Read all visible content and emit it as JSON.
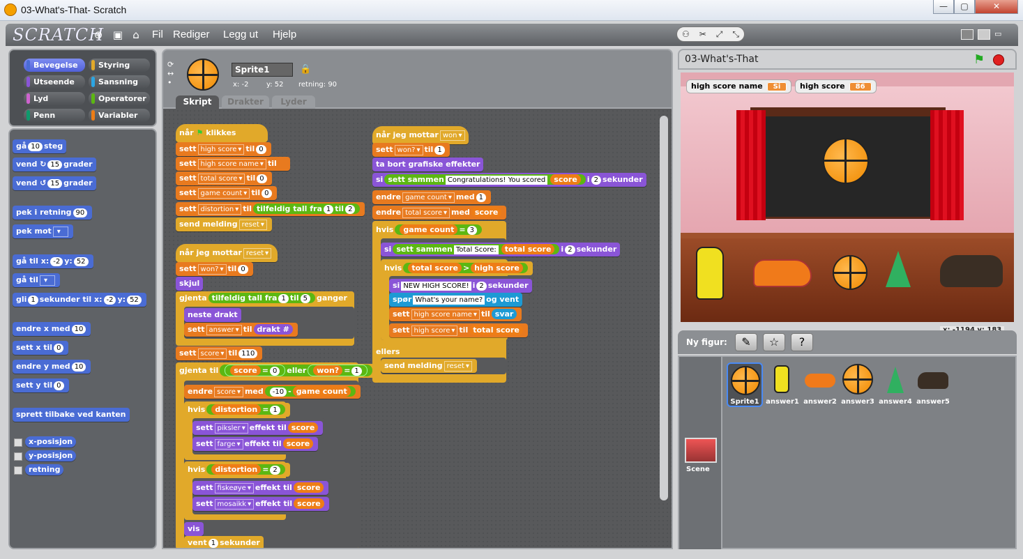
{
  "window": {
    "title": "03-What's-That- Scratch",
    "min": "—",
    "max": "▢",
    "close": "✕"
  },
  "menu": {
    "logo": "SCRATCH",
    "file": "Fil",
    "edit": "Rediger",
    "share": "Legg ut",
    "help": "Hjelp"
  },
  "categories": [
    "Bevegelse",
    "Styring",
    "Utseende",
    "Sansning",
    "Lyd",
    "Operatorer",
    "Penn",
    "Variabler"
  ],
  "palette": {
    "move": [
      "gå",
      "10",
      "steg"
    ],
    "turn_right": [
      "vend",
      "15",
      "grader"
    ],
    "turn_left": [
      "vend",
      "15",
      "grader"
    ],
    "point_dir": [
      "pek i retning",
      "90"
    ],
    "point_towards": [
      "pek mot"
    ],
    "goto_xy": [
      "gå til x:",
      "-2",
      "y:",
      "52"
    ],
    "goto": [
      "gå til"
    ],
    "glide": [
      "gli",
      "1",
      "sekunder til x:",
      "-2",
      "y:",
      "52"
    ],
    "change_x": [
      "endre x med",
      "10"
    ],
    "set_x": [
      "sett x til",
      "0"
    ],
    "change_y": [
      "endre y med",
      "10"
    ],
    "set_y": [
      "sett y til",
      "0"
    ],
    "bounce": "sprett tilbake ved kanten",
    "reporters": [
      "x-posisjon",
      "y-posisjon",
      "retning"
    ]
  },
  "sprite": {
    "name": "Sprite1",
    "x": "x: -2",
    "y": "y: 52",
    "dir": "retning: 90"
  },
  "tabs": [
    "Skript",
    "Drakter",
    "Lyder"
  ],
  "stage": {
    "title": "03-What's-That",
    "monitor1_label": "high score name",
    "monitor1_value": "Si",
    "monitor2_label": "high score",
    "monitor2_value": "86",
    "coords": "x: -1194  y: 183"
  },
  "sprite_list": {
    "new_label": "Ny figur:",
    "items": [
      "Sprite1",
      "answer1",
      "answer2",
      "answer3",
      "answer4",
      "answer5"
    ],
    "scene": "Scene"
  },
  "scripts": {
    "s1_hat": [
      "når",
      "klikkes"
    ],
    "s1_l1": [
      "sett",
      "high score",
      "til",
      "0"
    ],
    "s1_l2": [
      "sett",
      "high score name",
      "til",
      ""
    ],
    "s1_l3": [
      "sett",
      "total score",
      "til",
      "0"
    ],
    "s1_l4": [
      "sett",
      "game count",
      "til",
      "0"
    ],
    "s1_l5": [
      "sett",
      "distortion",
      "til",
      "tilfeldig tall fra",
      "1",
      "til",
      "2"
    ],
    "s1_l6": [
      "send melding",
      "reset"
    ],
    "s2_hat": [
      "når jeg mottar",
      "reset"
    ],
    "s2_l1": [
      "sett",
      "won?",
      "til",
      "0"
    ],
    "s2_l2": "skjul",
    "s2_l3": [
      "gjenta",
      "tilfeldig tall fra",
      "1",
      "til",
      "5",
      "ganger"
    ],
    "s2_l4": "neste drakt",
    "s2_l5": [
      "sett",
      "answer",
      "til",
      "drakt #"
    ],
    "s2_l6": [
      "sett",
      "score",
      "til",
      "110"
    ],
    "s2_l7": [
      "gjenta til",
      "score",
      "=",
      "0",
      "eller",
      "won?",
      "=",
      "1"
    ],
    "s2_l8": [
      "endre",
      "score",
      "med",
      "-10",
      "-",
      "game count"
    ],
    "s2_l9": [
      "hvis",
      "distortion",
      "=",
      "1"
    ],
    "s2_l10": [
      "sett",
      "piksler",
      "effekt til",
      "score"
    ],
    "s2_l11": [
      "sett",
      "farge",
      "effekt til",
      "score"
    ],
    "s2_l12": [
      "hvis",
      "distortion",
      "=",
      "2"
    ],
    "s2_l13": [
      "sett",
      "fiskeøye",
      "effekt til",
      "score"
    ],
    "s2_l14": [
      "sett",
      "mosaikk",
      "effekt til",
      "score"
    ],
    "s2_l15": "vis",
    "s2_l16": [
      "vent",
      "1",
      "sekunder"
    ],
    "s3_hat": [
      "når jeg mottar",
      "won"
    ],
    "s3_l1": [
      "sett",
      "won?",
      "til",
      "1"
    ],
    "s3_l2": "ta bort grafiske effekter",
    "s3_l3": [
      "si",
      "sett sammen",
      "Congratulations! You scored",
      "score",
      "i",
      "2",
      "sekunder"
    ],
    "s3_l4": [
      "endre",
      "game count",
      "med",
      "1"
    ],
    "s3_l5": [
      "endre",
      "total score",
      "med",
      "score"
    ],
    "s3_l6": [
      "hvis",
      "game count",
      "=",
      "3"
    ],
    "s3_l7": [
      "si",
      "sett sammen",
      "Total Score:",
      "total score",
      "i",
      "2",
      "sekunder"
    ],
    "s3_l8": [
      "hvis",
      "total score",
      ">",
      "high score"
    ],
    "s3_l9": [
      "si",
      "NEW HIGH SCORE!",
      "i",
      "2",
      "sekunder"
    ],
    "s3_l10": [
      "spør",
      "What's your name?",
      "og vent"
    ],
    "s3_l11": [
      "sett",
      "high score name",
      "til",
      "svar"
    ],
    "s3_l12": [
      "sett",
      "high score",
      "til",
      "total score"
    ],
    "s3_l13": "ellers",
    "s3_l14": [
      "send melding",
      "reset"
    ]
  }
}
